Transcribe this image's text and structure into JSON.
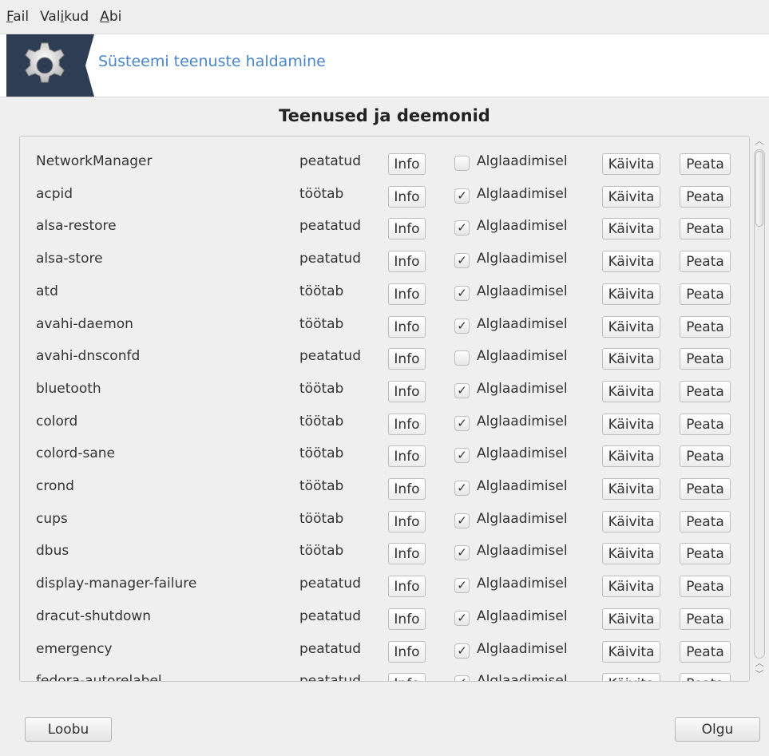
{
  "menubar": {
    "items": [
      {
        "accel": "F",
        "rest": "ail"
      },
      {
        "pre": "Val",
        "accel": "i",
        "rest": "kud"
      },
      {
        "accel": "A",
        "rest": "bi"
      }
    ]
  },
  "banner": {
    "title": "Süsteemi teenuste haldamine",
    "icon": "gear-icon",
    "icon_bg": "#2e3d53",
    "title_color": "#4a86c8"
  },
  "section_title": "Teenused ja deemonid",
  "labels": {
    "info": "Info",
    "boot": "Alglaadimisel",
    "start": "Käivita",
    "stop": "Peata",
    "checkmark": "✓"
  },
  "services": [
    {
      "name": "NetworkManager",
      "status": "peatatud",
      "on_boot": false
    },
    {
      "name": "acpid",
      "status": "töötab",
      "on_boot": true
    },
    {
      "name": "alsa-restore",
      "status": "peatatud",
      "on_boot": true
    },
    {
      "name": "alsa-store",
      "status": "peatatud",
      "on_boot": true
    },
    {
      "name": "atd",
      "status": "töötab",
      "on_boot": true
    },
    {
      "name": "avahi-daemon",
      "status": "töötab",
      "on_boot": true
    },
    {
      "name": "avahi-dnsconfd",
      "status": "peatatud",
      "on_boot": false
    },
    {
      "name": "bluetooth",
      "status": "töötab",
      "on_boot": true
    },
    {
      "name": "colord",
      "status": "töötab",
      "on_boot": true
    },
    {
      "name": "colord-sane",
      "status": "töötab",
      "on_boot": true
    },
    {
      "name": "crond",
      "status": "töötab",
      "on_boot": true
    },
    {
      "name": "cups",
      "status": "töötab",
      "on_boot": true
    },
    {
      "name": "dbus",
      "status": "töötab",
      "on_boot": true
    },
    {
      "name": "display-manager-failure",
      "status": "peatatud",
      "on_boot": true
    },
    {
      "name": "dracut-shutdown",
      "status": "peatatud",
      "on_boot": true
    },
    {
      "name": "emergency",
      "status": "peatatud",
      "on_boot": true
    },
    {
      "name": "fedora-autorelabel",
      "status": "peatatud",
      "on_boot": true
    }
  ],
  "scroll_fraction_visible": 0.15,
  "footer": {
    "cancel_label": "Loobu",
    "ok_label": "Olgu"
  }
}
